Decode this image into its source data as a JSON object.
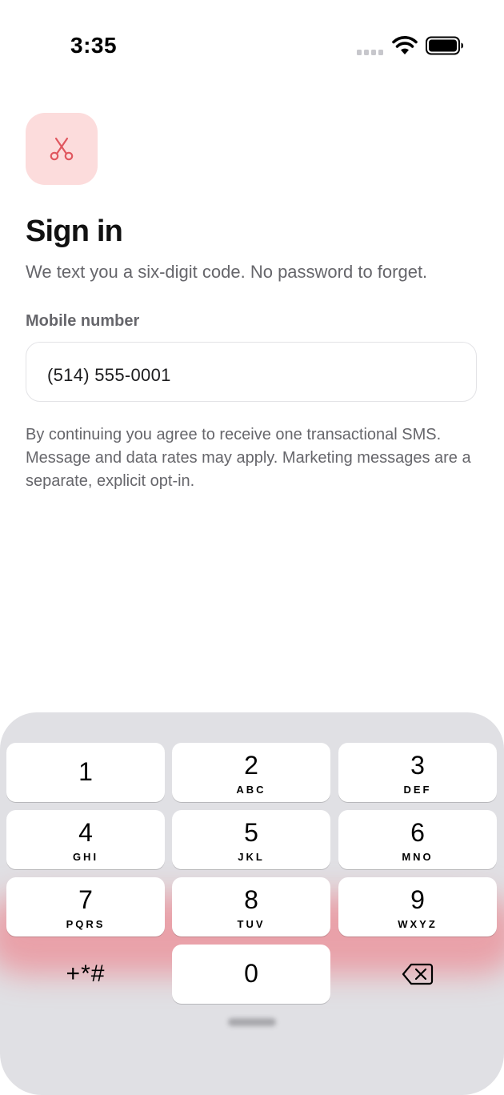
{
  "status_bar": {
    "time": "3:35",
    "signal_icon": "signal-dots-icon",
    "wifi_icon": "wifi-icon",
    "battery_icon": "battery-icon"
  },
  "app": {
    "icon": "scissors-icon",
    "icon_color": "#e0575f",
    "icon_bg": "#fcdcdc"
  },
  "signin": {
    "title": "Sign in",
    "subtitle": "We text you a six-digit code. No password to forget.",
    "field_label": "Mobile number",
    "phone_value": "(514) 555-0001",
    "disclaimer": "By continuing you agree to receive one transactional SMS. Message and data rates may apply. Marketing messages are a separate, explicit opt-in."
  },
  "keypad": {
    "keys": [
      {
        "digit": "1",
        "letters": ""
      },
      {
        "digit": "2",
        "letters": "ABC"
      },
      {
        "digit": "3",
        "letters": "DEF"
      },
      {
        "digit": "4",
        "letters": "GHI"
      },
      {
        "digit": "5",
        "letters": "JKL"
      },
      {
        "digit": "6",
        "letters": "MNO"
      },
      {
        "digit": "7",
        "letters": "PQRS"
      },
      {
        "digit": "8",
        "letters": "TUV"
      },
      {
        "digit": "9",
        "letters": "WXYZ"
      },
      {
        "digit": "0",
        "letters": ""
      }
    ],
    "symbols_label": "+*#",
    "backspace_icon": "backspace-icon"
  }
}
